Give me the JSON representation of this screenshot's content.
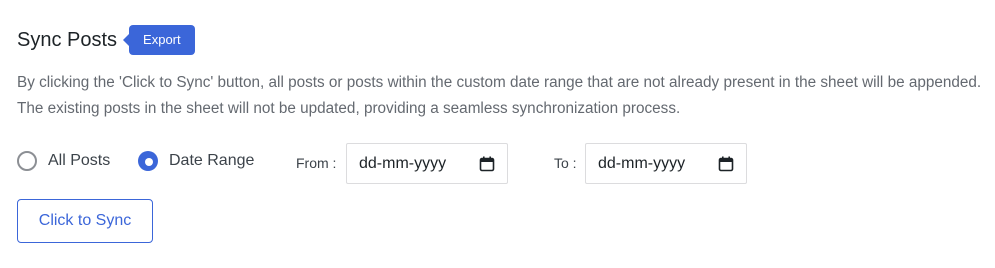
{
  "header": {
    "title": "Sync Posts",
    "badge": "Export"
  },
  "description": "By clicking the 'Click to Sync' button, all posts or posts within the custom date range that are not already present in the sheet will be appended. The existing posts in the sheet will not be updated, providing a seamless synchronization process.",
  "options": {
    "all_posts_label": "All Posts",
    "date_range_label": "Date Range",
    "selected": "Date Range"
  },
  "date_range": {
    "from_label": "From :",
    "from_value": "dd-mm-yyyy",
    "to_label": "To :",
    "to_value": "dd-mm-yyyy",
    "icon": "calendar-icon"
  },
  "actions": {
    "sync_label": "Click to Sync"
  },
  "colors": {
    "accent": "#3b66d9",
    "text": "#1d2327",
    "muted": "#646970",
    "border": "#dcdcde"
  }
}
